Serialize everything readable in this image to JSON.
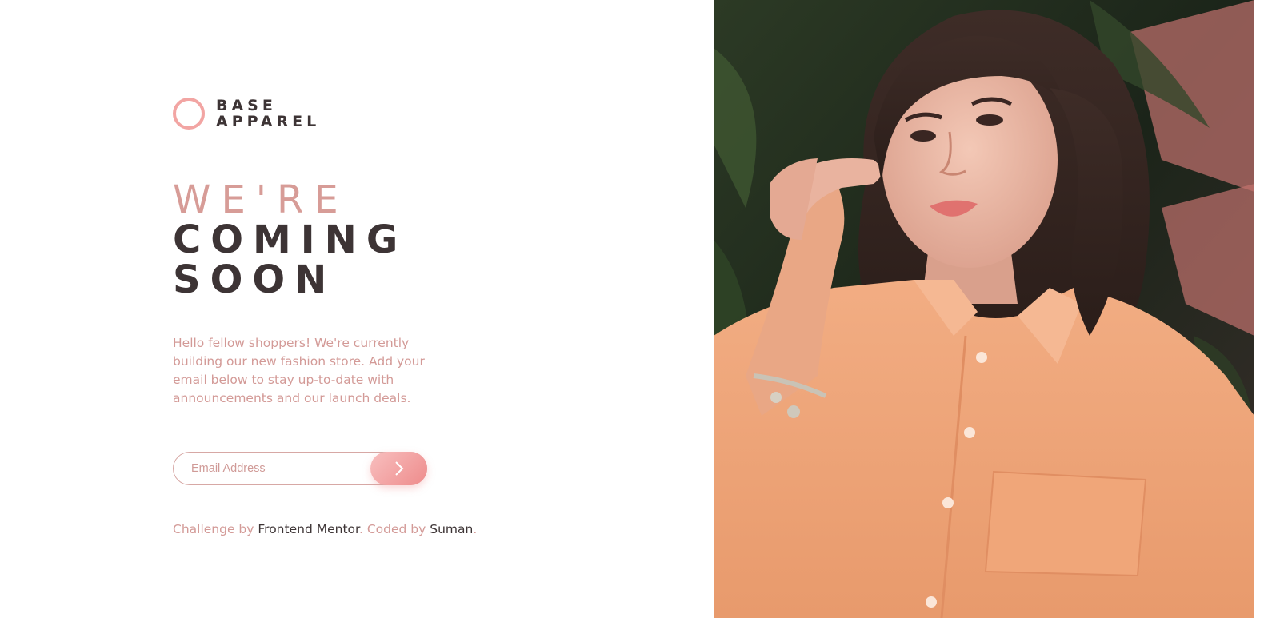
{
  "brand": {
    "line1": "BASE",
    "line2": "APPAREL",
    "accent_color": "#f2a5a3",
    "text_color": "#3d3435"
  },
  "heading": {
    "line1": "We're",
    "line2": "coming",
    "line3": "soon"
  },
  "intro": "Hello fellow shoppers! We're currently building our new fashion store. Add your email below to stay up-to-date with announcements and our launch deals.",
  "form": {
    "email_placeholder": "Email Address",
    "email_value": "",
    "submit_icon": "arrow-right-icon"
  },
  "attribution": {
    "challenge_prefix": "Challenge by",
    "challenge_link": "Frontend Mentor",
    "separator": ".",
    "coded_prefix": "Coded by",
    "coded_link": "Suman",
    "end": "."
  },
  "hero": {
    "icon": "hero-photo-woman-icon",
    "description_color_bg": "#1d2a20",
    "shirt_color": "#f0a678"
  }
}
